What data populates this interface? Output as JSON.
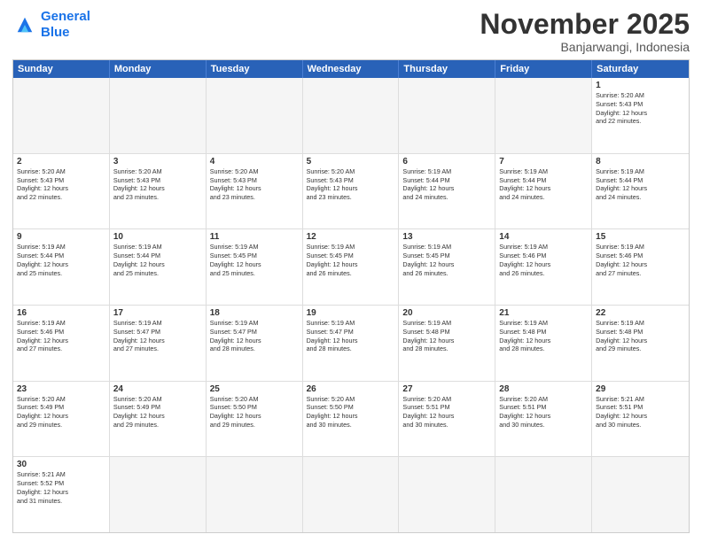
{
  "logo": {
    "line1": "General",
    "line2": "Blue"
  },
  "title": "November 2025",
  "subtitle": "Banjarwangi, Indonesia",
  "header_days": [
    "Sunday",
    "Monday",
    "Tuesday",
    "Wednesday",
    "Thursday",
    "Friday",
    "Saturday"
  ],
  "weeks": [
    [
      {
        "day": "",
        "info": ""
      },
      {
        "day": "",
        "info": ""
      },
      {
        "day": "",
        "info": ""
      },
      {
        "day": "",
        "info": ""
      },
      {
        "day": "",
        "info": ""
      },
      {
        "day": "",
        "info": ""
      },
      {
        "day": "1",
        "info": "Sunrise: 5:20 AM\nSunset: 5:43 PM\nDaylight: 12 hours\nand 22 minutes."
      }
    ],
    [
      {
        "day": "2",
        "info": "Sunrise: 5:20 AM\nSunset: 5:43 PM\nDaylight: 12 hours\nand 22 minutes."
      },
      {
        "day": "3",
        "info": "Sunrise: 5:20 AM\nSunset: 5:43 PM\nDaylight: 12 hours\nand 23 minutes."
      },
      {
        "day": "4",
        "info": "Sunrise: 5:20 AM\nSunset: 5:43 PM\nDaylight: 12 hours\nand 23 minutes."
      },
      {
        "day": "5",
        "info": "Sunrise: 5:20 AM\nSunset: 5:43 PM\nDaylight: 12 hours\nand 23 minutes."
      },
      {
        "day": "6",
        "info": "Sunrise: 5:19 AM\nSunset: 5:44 PM\nDaylight: 12 hours\nand 24 minutes."
      },
      {
        "day": "7",
        "info": "Sunrise: 5:19 AM\nSunset: 5:44 PM\nDaylight: 12 hours\nand 24 minutes."
      },
      {
        "day": "8",
        "info": "Sunrise: 5:19 AM\nSunset: 5:44 PM\nDaylight: 12 hours\nand 24 minutes."
      }
    ],
    [
      {
        "day": "9",
        "info": "Sunrise: 5:19 AM\nSunset: 5:44 PM\nDaylight: 12 hours\nand 25 minutes."
      },
      {
        "day": "10",
        "info": "Sunrise: 5:19 AM\nSunset: 5:44 PM\nDaylight: 12 hours\nand 25 minutes."
      },
      {
        "day": "11",
        "info": "Sunrise: 5:19 AM\nSunset: 5:45 PM\nDaylight: 12 hours\nand 25 minutes."
      },
      {
        "day": "12",
        "info": "Sunrise: 5:19 AM\nSunset: 5:45 PM\nDaylight: 12 hours\nand 26 minutes."
      },
      {
        "day": "13",
        "info": "Sunrise: 5:19 AM\nSunset: 5:45 PM\nDaylight: 12 hours\nand 26 minutes."
      },
      {
        "day": "14",
        "info": "Sunrise: 5:19 AM\nSunset: 5:46 PM\nDaylight: 12 hours\nand 26 minutes."
      },
      {
        "day": "15",
        "info": "Sunrise: 5:19 AM\nSunset: 5:46 PM\nDaylight: 12 hours\nand 27 minutes."
      }
    ],
    [
      {
        "day": "16",
        "info": "Sunrise: 5:19 AM\nSunset: 5:46 PM\nDaylight: 12 hours\nand 27 minutes."
      },
      {
        "day": "17",
        "info": "Sunrise: 5:19 AM\nSunset: 5:47 PM\nDaylight: 12 hours\nand 27 minutes."
      },
      {
        "day": "18",
        "info": "Sunrise: 5:19 AM\nSunset: 5:47 PM\nDaylight: 12 hours\nand 28 minutes."
      },
      {
        "day": "19",
        "info": "Sunrise: 5:19 AM\nSunset: 5:47 PM\nDaylight: 12 hours\nand 28 minutes."
      },
      {
        "day": "20",
        "info": "Sunrise: 5:19 AM\nSunset: 5:48 PM\nDaylight: 12 hours\nand 28 minutes."
      },
      {
        "day": "21",
        "info": "Sunrise: 5:19 AM\nSunset: 5:48 PM\nDaylight: 12 hours\nand 28 minutes."
      },
      {
        "day": "22",
        "info": "Sunrise: 5:19 AM\nSunset: 5:48 PM\nDaylight: 12 hours\nand 29 minutes."
      }
    ],
    [
      {
        "day": "23",
        "info": "Sunrise: 5:20 AM\nSunset: 5:49 PM\nDaylight: 12 hours\nand 29 minutes."
      },
      {
        "day": "24",
        "info": "Sunrise: 5:20 AM\nSunset: 5:49 PM\nDaylight: 12 hours\nand 29 minutes."
      },
      {
        "day": "25",
        "info": "Sunrise: 5:20 AM\nSunset: 5:50 PM\nDaylight: 12 hours\nand 29 minutes."
      },
      {
        "day": "26",
        "info": "Sunrise: 5:20 AM\nSunset: 5:50 PM\nDaylight: 12 hours\nand 30 minutes."
      },
      {
        "day": "27",
        "info": "Sunrise: 5:20 AM\nSunset: 5:51 PM\nDaylight: 12 hours\nand 30 minutes."
      },
      {
        "day": "28",
        "info": "Sunrise: 5:20 AM\nSunset: 5:51 PM\nDaylight: 12 hours\nand 30 minutes."
      },
      {
        "day": "29",
        "info": "Sunrise: 5:21 AM\nSunset: 5:51 PM\nDaylight: 12 hours\nand 30 minutes."
      }
    ],
    [
      {
        "day": "30",
        "info": "Sunrise: 5:21 AM\nSunset: 5:52 PM\nDaylight: 12 hours\nand 31 minutes."
      },
      {
        "day": "",
        "info": ""
      },
      {
        "day": "",
        "info": ""
      },
      {
        "day": "",
        "info": ""
      },
      {
        "day": "",
        "info": ""
      },
      {
        "day": "",
        "info": ""
      },
      {
        "day": "",
        "info": ""
      }
    ]
  ]
}
